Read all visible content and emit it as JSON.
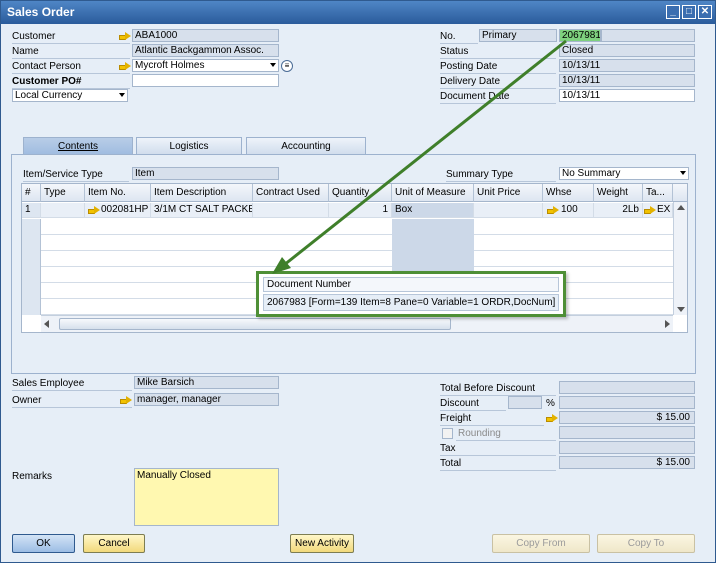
{
  "window": {
    "title": "Sales Order",
    "buttons": [
      "_",
      "□",
      "✕"
    ]
  },
  "header_left": {
    "customer": {
      "label": "Customer",
      "value": "ABA1000"
    },
    "name": {
      "label": "Name",
      "value": "Atlantic Backgammon Assoc."
    },
    "contact_person": {
      "label": "Contact Person",
      "value": "Mycroft Holmes"
    },
    "customer_po": {
      "label": "Customer PO#",
      "value": ""
    },
    "currency": {
      "value": "Local Currency"
    }
  },
  "header_right": {
    "no": {
      "label": "No.",
      "series": "Primary",
      "value": "2067981"
    },
    "status": {
      "label": "Status",
      "value": "Closed"
    },
    "posting_date": {
      "label": "Posting Date",
      "value": "10/13/11"
    },
    "delivery_date": {
      "label": "Delivery Date",
      "value": "10/13/11"
    },
    "document_date": {
      "label": "Document Date",
      "value": "10/13/11"
    }
  },
  "tabs": [
    {
      "label": "Contents",
      "active": true
    },
    {
      "label": "Logistics",
      "active": false
    },
    {
      "label": "Accounting",
      "active": false
    }
  ],
  "contents": {
    "item_service_type": {
      "label": "Item/Service Type",
      "value": "Item"
    },
    "summary_type": {
      "label": "Summary Type",
      "value": "No Summary"
    },
    "columns": [
      "#",
      "Type",
      "Item No.",
      "Item Description",
      "Contract Used",
      "Quantity",
      "Unit of Measure",
      "Unit Price",
      "Whse",
      "Weight",
      "Ta..."
    ],
    "rows": [
      {
        "num": "1",
        "type": "",
        "item_no": "002081HP",
        "description": "3/1M CT SALT PACKE",
        "contract": "",
        "quantity": "1",
        "uom": "Box",
        "unit_price": "",
        "whse": "100",
        "weight": "2Lb",
        "tax": "EX"
      }
    ]
  },
  "tooltip": {
    "title": "Document Number",
    "text": "2067983 [Form=139 Item=8 Pane=0 Variable=1 ORDR,DocNum]"
  },
  "footer_left": {
    "sales_employee": {
      "label": "Sales Employee",
      "value": "Mike Barsich"
    },
    "owner": {
      "label": "Owner",
      "value": "manager, manager"
    },
    "remarks": {
      "label": "Remarks",
      "value": "Manually Closed"
    }
  },
  "totals": {
    "before_discount": {
      "label": "Total Before Discount",
      "value": ""
    },
    "discount": {
      "label": "Discount",
      "percent_symbol": "%",
      "value": ""
    },
    "freight": {
      "label": "Freight",
      "value": "$ 15.00"
    },
    "rounding": {
      "label": "Rounding",
      "value": ""
    },
    "tax": {
      "label": "Tax",
      "value": ""
    },
    "total": {
      "label": "Total",
      "value": "$ 15.00"
    }
  },
  "buttons": {
    "ok": "OK",
    "cancel": "Cancel",
    "new_activity": "New Activity",
    "copy_from": "Copy From",
    "copy_to": "Copy To"
  },
  "colors": {
    "highlight": "#7ed17e",
    "annotation_arrow": "#3f7f2a",
    "remarks_bg": "#fff8b0"
  }
}
